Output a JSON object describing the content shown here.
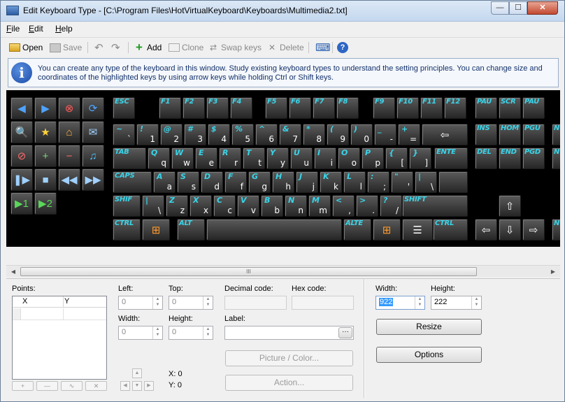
{
  "window": {
    "title": "Edit Keyboard Type - [C:\\Program Files\\HotVirtualKeyboard\\Keyboards\\Multimedia2.txt]",
    "min_glyph": "—",
    "max_glyph": "☐",
    "close_glyph": "✕"
  },
  "menu": {
    "items": [
      "File",
      "Edit",
      "Help"
    ]
  },
  "toolbar": {
    "open": "Open",
    "save": "Save",
    "undo_icon": "↶",
    "redo_icon": "↷",
    "add": "Add",
    "clone": "Clone",
    "swap": "Swap keys",
    "delete": "Delete",
    "keyboard_icon": "⌨",
    "help_icon": "?"
  },
  "info": {
    "icon": "i",
    "text": "You can create any type of the keyboard in this window. Study existing keyboard types to understand the setting principles. You can change size and coordinates of the highlighted keys by using arrow keys while holding Ctrl or Shift keys."
  },
  "keyboard": {
    "media_keys": [
      "back-icon",
      "forward-icon",
      "stop-icon",
      "refresh-icon",
      "search-icon",
      "favorites-icon",
      "home-icon",
      "mail-icon",
      "mute-icon",
      "volume-up-icon",
      "volume-down-icon",
      "music-icon",
      "play-pause-icon",
      "stop-media-icon",
      "prev-track-icon",
      "next-track-icon",
      "app1-icon",
      "app2-icon"
    ],
    "media_glyphs": [
      "◀",
      "▶",
      "⊗",
      "⟳",
      "🔍",
      "★",
      "⌂",
      "✉",
      "⊘",
      "+",
      "−",
      "♫",
      "❚▶",
      "■",
      "◀◀",
      "▶▶",
      "▶1",
      "▶2"
    ],
    "fn_row": [
      "ESC",
      "F1",
      "F2",
      "F3",
      "F4",
      "F5",
      "F6",
      "F7",
      "F8",
      "F9",
      "F10",
      "F11",
      "F12",
      "PAU",
      "SCR",
      "PAU"
    ],
    "num_row": [
      [
        "~",
        "`"
      ],
      [
        "!",
        "1"
      ],
      [
        "@",
        "2"
      ],
      [
        "#",
        "3"
      ],
      [
        "$",
        "4"
      ],
      [
        "%",
        "5"
      ],
      [
        "^",
        "6"
      ],
      [
        "&",
        "7"
      ],
      [
        "*",
        "8"
      ],
      [
        "(",
        "9"
      ],
      [
        ")",
        "0"
      ],
      [
        "_",
        "-"
      ],
      [
        "+",
        "="
      ]
    ],
    "q_row": [
      [
        "Q",
        "q"
      ],
      [
        "W",
        "w"
      ],
      [
        "E",
        "e"
      ],
      [
        "R",
        "r"
      ],
      [
        "T",
        "t"
      ],
      [
        "Y",
        "y"
      ],
      [
        "U",
        "u"
      ],
      [
        "I",
        "i"
      ],
      [
        "O",
        "o"
      ],
      [
        "P",
        "p"
      ],
      [
        "{",
        "["
      ],
      [
        "}",
        "]"
      ]
    ],
    "a_row": [
      [
        "A",
        "a"
      ],
      [
        "S",
        "s"
      ],
      [
        "D",
        "d"
      ],
      [
        "F",
        "f"
      ],
      [
        "G",
        "g"
      ],
      [
        "H",
        "h"
      ],
      [
        "J",
        "j"
      ],
      [
        "K",
        "k"
      ],
      [
        "L",
        "l"
      ],
      [
        ":",
        ";"
      ],
      [
        "\"",
        "'"
      ],
      [
        "|",
        "\\"
      ]
    ],
    "z_row": [
      [
        "|",
        "\\"
      ],
      [
        "Z",
        "z"
      ],
      [
        "X",
        "x"
      ],
      [
        "C",
        "c"
      ],
      [
        "V",
        "v"
      ],
      [
        "B",
        "b"
      ],
      [
        "N",
        "n"
      ],
      [
        "M",
        "m"
      ],
      [
        "<",
        ","
      ],
      [
        ">",
        "."
      ],
      [
        "?",
        "/"
      ]
    ],
    "labels": {
      "tab": "TAB",
      "caps": "CAPS",
      "shift_l": "SHIF",
      "shift_r": "SHIFT",
      "ctrl_l": "CTRL",
      "alt_l": "ALT",
      "alt_r": "ALTE",
      "ctrl_r": "CTRL",
      "enter": "ENTE",
      "ins": "INS",
      "home": "HOM",
      "pgup": "PGU",
      "del": "DEL",
      "end": "END",
      "pgdn": "PGD",
      "r1": "N",
      "r2": "N"
    },
    "glyphs": {
      "backspace": "⇦",
      "up": "⇧",
      "left": "⇦",
      "down": "⇩",
      "right": "⇨",
      "win": "⊞",
      "menu": "☰"
    }
  },
  "scrollbar": {
    "left": "◀",
    "right": "▶",
    "thumb": "III"
  },
  "panel": {
    "points_label": "Points:",
    "col_x": "X",
    "col_y": "Y",
    "point_buttons": [
      "+",
      "—",
      "∿",
      "✕"
    ],
    "left_label": "Left:",
    "left_value": "0",
    "top_label": "Top:",
    "top_value": "0",
    "width_label": "Width:",
    "width_value": "0",
    "height_label": "Height:",
    "height_value": "0",
    "decimal_label": "Decimal code:",
    "hex_label": "Hex code:",
    "label_label": "Label:",
    "browse": "···",
    "picture_button": "Picture / Color...",
    "action_button": "Action...",
    "x_coord": "X: 0",
    "y_coord": "Y: 0",
    "nav": [
      "▲",
      "◀",
      "▼",
      "▶"
    ]
  },
  "right_panel": {
    "width_label": "Width:",
    "width_value": "922",
    "height_label": "Height:",
    "height_value": "222",
    "resize": "Resize",
    "options": "Options"
  }
}
